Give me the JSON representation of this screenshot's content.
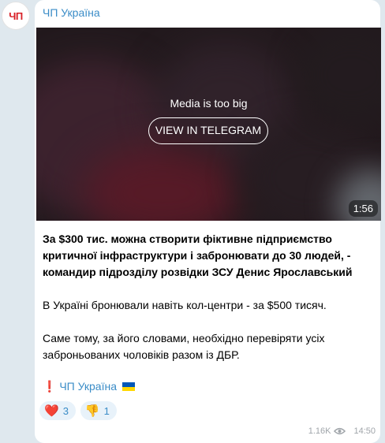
{
  "channel": {
    "name": "ЧП Україна",
    "avatar_text": "ЧП"
  },
  "media": {
    "notice": "Media is too big",
    "button_label": "VIEW IN TELEGRAM",
    "duration": "1:56"
  },
  "message": {
    "paragraphs": [
      "За $300 тис. можна створити фіктивне підприємство критичної інфраструктури і забронювати до 30 людей, - командир підрозділу розвідки ЗСУ Денис Ярославський",
      "В Україні бронювали навіть кол-центри - за $500 тисяч.",
      "Саме тому, за його словами, необхідно перевіряти усіх заброньованих чоловіків разом із ДБР."
    ],
    "signature_mark": "❗",
    "signature": "ЧП Україна",
    "flag_colors": [
      "#0057b7",
      "#ffd700"
    ]
  },
  "reactions": [
    {
      "emoji": "❤️",
      "count": "3"
    },
    {
      "emoji": "👎",
      "count": "1"
    }
  ],
  "meta": {
    "views": "1.16K",
    "time": "14:50"
  }
}
